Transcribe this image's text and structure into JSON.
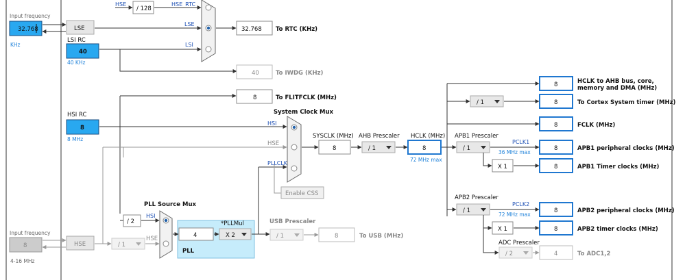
{
  "labels": {
    "input_frequency_top": "Input frequency",
    "input_frequency_bottom": "Input frequency",
    "khz": "KHz",
    "range_4_16": "4-16 MHz",
    "lsi_rc": "LSI RC",
    "lsi_khz": "40 KHz",
    "hsi_rc": "HSI RC",
    "hsi_mhz": "8 MHz",
    "system_clock_mux": "System Clock Mux",
    "pll_source_mux": "PLL Source Mux",
    "pll": "PLL",
    "pllmul": "*PLLMul",
    "usb_prescaler": "USB Prescaler",
    "sysclk_mhz": "SYSCLK (MHz)",
    "ahb_prescaler": "AHB Prescaler",
    "hclk_mhz": "HCLK (MHz)",
    "hclk_max": "72 MHz max",
    "apb1_prescaler": "APB1 Prescaler",
    "apb2_prescaler": "APB2 Prescaler",
    "adc_prescaler": "ADC Prescaler",
    "pclk1": "PCLK1",
    "pclk1_max": "36 MHz max",
    "pclk2": "PCLK2",
    "pclk2_max": "72 MHz max",
    "wire_hse_top": "HSE",
    "wire_hse_rtc": "HSE_RTC",
    "wire_lse": "LSE",
    "wire_lsi": "LSI",
    "wire_hsi": "HSI",
    "wire_hse": "HSE",
    "wire_pllclk": "PLLCLK",
    "wire_hsi_pll": "HSI",
    "wire_hse_pll": "HSE"
  },
  "blocks": {
    "lse": "LSE",
    "hse": "HSE"
  },
  "inputs": {
    "lse_freq": "32.768",
    "lsi_freq": "40",
    "hsi_freq": "8",
    "hse_freq": "8",
    "pll_value": "4"
  },
  "prescalers": {
    "hse_rtc_div": "/ 128",
    "hse_div": "/ 1",
    "pll_hsi_div": "/ 2",
    "pllmul": "X 2",
    "usb": "/ 1",
    "ahb": "/ 1",
    "apb1": "/ 1",
    "apb2": "/ 1",
    "adc": "/ 2",
    "cortex": "/ 1",
    "apb1_timer_mul": "X 1",
    "apb2_timer_mul": "X 1"
  },
  "values": {
    "rtc": "32.768",
    "iwdg": "40",
    "flitfclk": "8",
    "sysclk": "8",
    "hclk": "8",
    "usb": "8",
    "hclk_ahb": "8",
    "cortex_timer": "8",
    "fclk": "8",
    "apb1_periph": "8",
    "apb1_timer": "8",
    "apb2_periph": "8",
    "apb2_timer": "8",
    "adc": "4"
  },
  "outputs": {
    "rtc": "To RTC (KHz)",
    "iwdg": "To IWDG (KHz)",
    "flitfclk": "To FLITFCLK (MHz)",
    "usb": "To USB (MHz)",
    "hclk_ahb_line1": "HCLK to AHB bus, core,",
    "hclk_ahb_line2": "memory and DMA (MHz)",
    "cortex_timer": "To Cortex System timer (MHz)",
    "fclk": "FCLK (MHz)",
    "apb1_periph": "APB1 peripheral clocks (MHz)",
    "apb1_timer": "APB1 Timer clocks (MHz)",
    "apb2_periph": "APB2 peripheral clocks (MHz)",
    "apb2_timer": "APB2 timer clocks (MHz)",
    "adc": "To ADC1,2"
  },
  "buttons": {
    "enable_css": "Enable CSS"
  },
  "mux_state": {
    "rtc_selected": "LSE",
    "system_selected": "HSI",
    "pll_source_selected": "HSI"
  }
}
